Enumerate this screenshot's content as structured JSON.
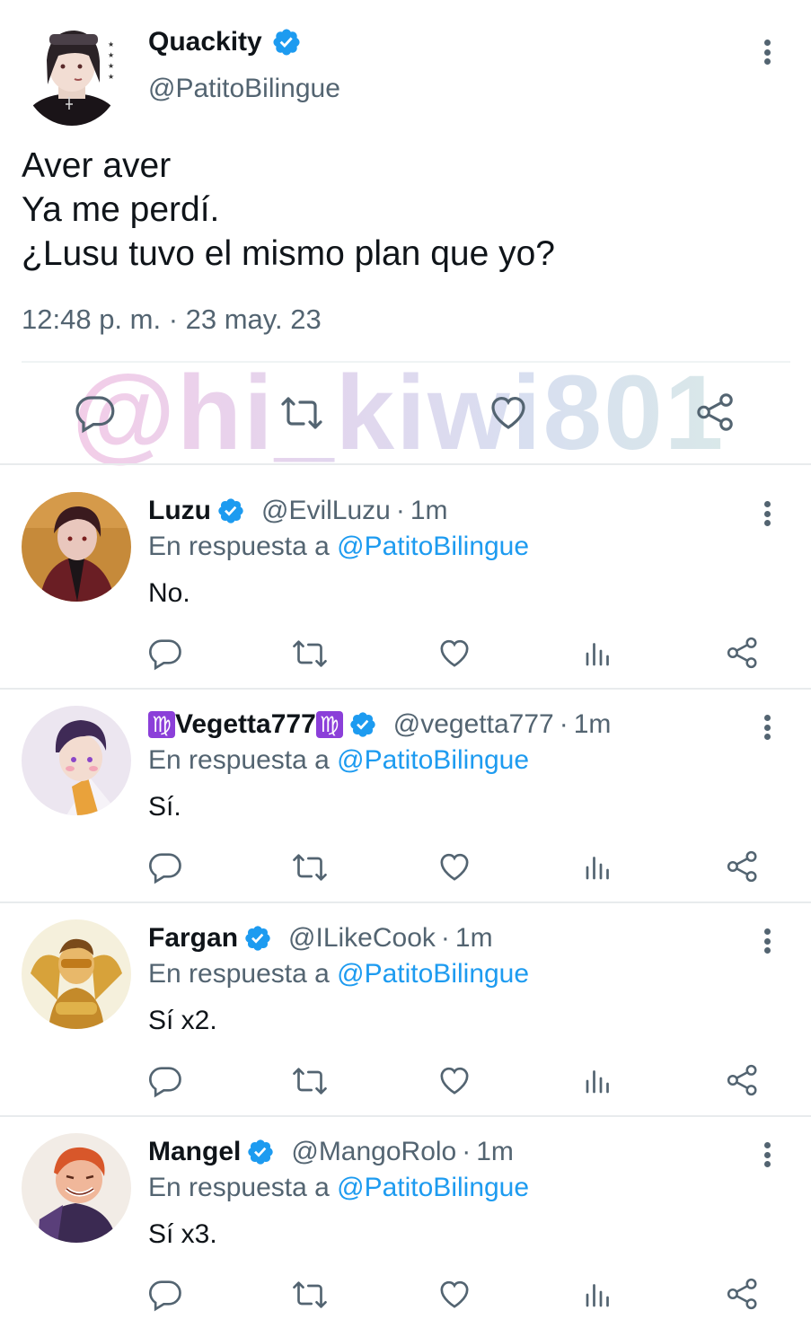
{
  "main_tweet": {
    "name": "Quackity",
    "handle": "@PatitoBilingue",
    "text_lines": [
      "Aver aver",
      "Ya me perdí.",
      "¿Lusu tuvo el mismo plan que yo?"
    ],
    "timestamp": "12:48 p. m. · 23 may. 23",
    "watermark": "@hi_kiwi801",
    "actions": [
      "reply-icon",
      "retweet-icon",
      "like-icon",
      "share-icon"
    ]
  },
  "replies": [
    {
      "name": "Luzu",
      "handle": "@EvilLuzu",
      "sep": "·",
      "time": "1m",
      "reply_prefix": "En respuesta a",
      "mention": "@PatitoBilingue",
      "text": "No."
    },
    {
      "name": "Vegetta777",
      "name_decor": "♍",
      "handle": "@vegetta777",
      "sep": "·",
      "time": "1m",
      "reply_prefix": "En respuesta a",
      "mention": "@PatitoBilingue",
      "text": "Sí."
    },
    {
      "name": "Fargan",
      "handle": "@ILikeCook",
      "sep": "·",
      "time": "1m",
      "reply_prefix": "En respuesta a",
      "mention": "@PatitoBilingue",
      "text": "Sí x2."
    },
    {
      "name": "Mangel",
      "handle": "@MangoRolo",
      "sep": "·",
      "time": "1m",
      "reply_prefix": "En respuesta a",
      "mention": "@PatitoBilingue",
      "text": "Sí x3."
    }
  ],
  "colors": {
    "verified": "#1d9bf0",
    "mention": "#1d9bf0",
    "muted": "#536471",
    "text": "#0f1419"
  }
}
